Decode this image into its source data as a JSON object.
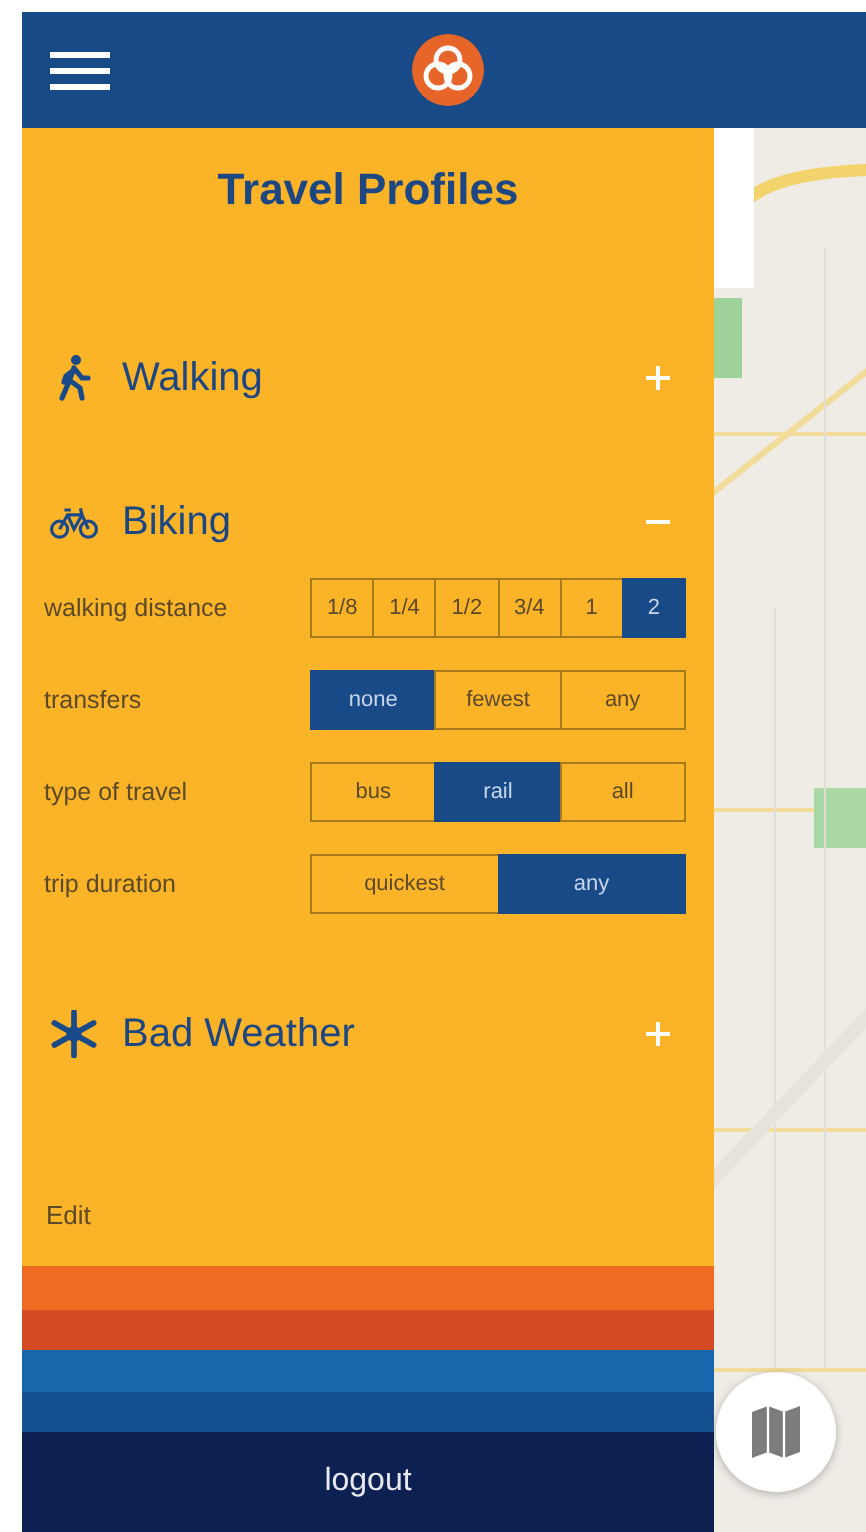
{
  "title": "Travel Profiles",
  "profiles": [
    {
      "label": "Walking",
      "expanded": false
    },
    {
      "label": "Biking",
      "expanded": true,
      "options": [
        {
          "label": "walking distance",
          "choices": [
            {
              "label": "1/8",
              "selected": false
            },
            {
              "label": "1/4",
              "selected": false
            },
            {
              "label": "1/2",
              "selected": false
            },
            {
              "label": "3/4",
              "selected": false
            },
            {
              "label": "1",
              "selected": false
            },
            {
              "label": "2",
              "selected": true
            }
          ]
        },
        {
          "label": "transfers",
          "choices": [
            {
              "label": "none",
              "selected": true
            },
            {
              "label": "fewest",
              "selected": false
            },
            {
              "label": "any",
              "selected": false
            }
          ]
        },
        {
          "label": "type of travel",
          "choices": [
            {
              "label": "bus",
              "selected": false
            },
            {
              "label": "rail",
              "selected": true
            },
            {
              "label": "all",
              "selected": false
            }
          ]
        },
        {
          "label": "trip duration",
          "choices": [
            {
              "label": "quickest",
              "selected": false
            },
            {
              "label": "any",
              "selected": true
            }
          ]
        }
      ]
    },
    {
      "label": "Bad Weather",
      "expanded": false
    }
  ],
  "edit": "Edit",
  "logout": "logout"
}
